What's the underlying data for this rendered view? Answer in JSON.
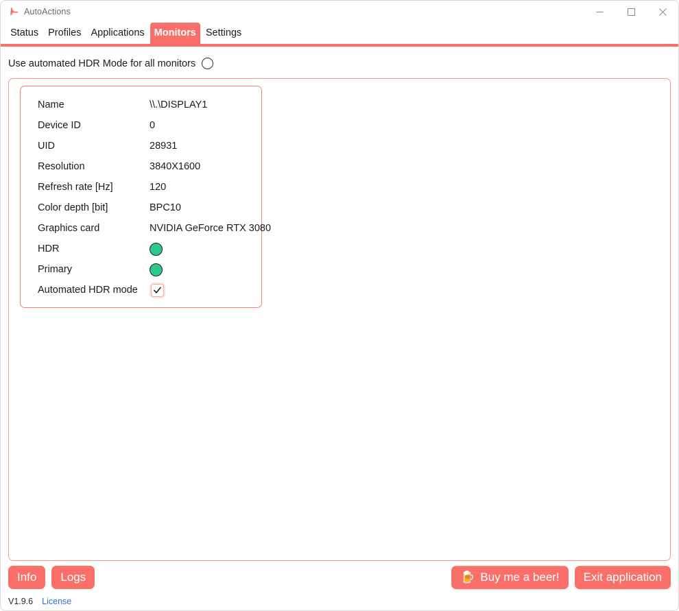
{
  "window": {
    "title": "AutoActions",
    "app_icon": "pulse-spike-icon",
    "controls": {
      "minimize": "minimize-icon",
      "maximize": "maximize-icon",
      "close": "close-icon"
    }
  },
  "colors": {
    "accent": "#fa6f69",
    "accent_border": "#f4837b",
    "panel_border": "#f79a94",
    "status_green": "#2fc78a",
    "link_blue": "#2f6fd0",
    "text": "#1a1a1a"
  },
  "tabs": [
    {
      "label": "Status",
      "active": false
    },
    {
      "label": "Profiles",
      "active": false
    },
    {
      "label": "Applications",
      "active": false
    },
    {
      "label": "Monitors",
      "active": true
    },
    {
      "label": "Settings",
      "active": false
    }
  ],
  "global_toggle": {
    "label": "Use automated HDR Mode for all monitors",
    "checked": false,
    "icon": "radio-circle-unchecked-icon"
  },
  "monitor": {
    "rows": [
      {
        "label": "Name",
        "value": "\\\\.\\DISPLAY1",
        "type": "text"
      },
      {
        "label": "Device ID",
        "value": "0",
        "type": "text"
      },
      {
        "label": "UID",
        "value": "28931",
        "type": "text"
      },
      {
        "label": "Resolution",
        "value": "3840X1600",
        "type": "text"
      },
      {
        "label": "Refresh rate [Hz]",
        "value": "120",
        "type": "text"
      },
      {
        "label": "Color depth [bit]",
        "value": "BPC10",
        "type": "text"
      },
      {
        "label": "Graphics card",
        "value": "NVIDIA GeForce RTX 3080",
        "type": "text"
      },
      {
        "label": "HDR",
        "value": "",
        "type": "dot",
        "state": "on"
      },
      {
        "label": "Primary",
        "value": "",
        "type": "dot",
        "state": "on"
      },
      {
        "label": "Automated HDR mode",
        "value": "",
        "type": "checkbox",
        "state": "checked"
      }
    ]
  },
  "bottom": {
    "info_label": "Info",
    "logs_label": "Logs",
    "beer_label": "Buy me a beer!",
    "beer_icon": "beer-mug-icon",
    "exit_label": "Exit application"
  },
  "status": {
    "version": "V1.9.6",
    "license_label": "License"
  }
}
